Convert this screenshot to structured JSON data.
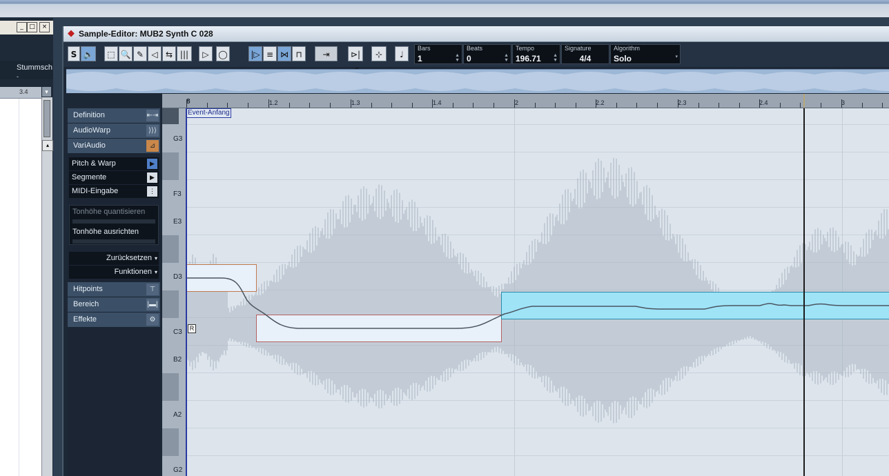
{
  "left_window": {
    "controls": [
      "_",
      "□",
      "×"
    ],
    "column_header": "Stummschalten",
    "dash": "-",
    "ruler_label": "3.4",
    "dropdown_arrow": "▾",
    "scroll_arrow": "▴"
  },
  "sample_editor": {
    "title": "Sample-Editor: MUB2 Synth C 028",
    "toolbar": {
      "buttons": [
        {
          "name": "solo-button",
          "glyph": "S"
        },
        {
          "name": "listen-button",
          "glyph": "🔈"
        },
        {
          "name": "range-select-tool",
          "glyph": "⬚"
        },
        {
          "name": "zoom-tool",
          "glyph": "🔍"
        },
        {
          "name": "draw-tool",
          "glyph": "✎"
        },
        {
          "name": "play-tool",
          "glyph": "◁"
        },
        {
          "name": "warp-tool",
          "glyph": "⇆"
        },
        {
          "name": "hitpoint-tool",
          "glyph": "|||"
        },
        {
          "name": "play-button",
          "glyph": "▷"
        },
        {
          "name": "loop-button",
          "glyph": "◯"
        },
        {
          "name": "pitch-warp-tool",
          "glyph": "|▷"
        },
        {
          "name": "segment-tool",
          "glyph": "≡"
        },
        {
          "name": "snap-tool",
          "glyph": "⋈"
        },
        {
          "name": "quantize-tool",
          "glyph": "⊓"
        },
        {
          "name": "musical-mode-button",
          "glyph": "⇥"
        },
        {
          "name": "auto-scroll-button",
          "glyph": "⊳|⊲"
        },
        {
          "name": "snap-zero-button",
          "glyph": "⊹"
        },
        {
          "name": "note-button",
          "glyph": "♩"
        }
      ],
      "fields": {
        "bars": {
          "label": "Bars",
          "value": "1"
        },
        "beats": {
          "label": "Beats",
          "value": "0"
        },
        "tempo": {
          "label": "Tempo",
          "value": "196.71"
        },
        "signature": {
          "label": "Signature",
          "value": "4/4"
        },
        "algorithm": {
          "label": "Algorithm",
          "value": "Solo"
        }
      }
    },
    "inspector": {
      "sections": [
        {
          "label": "Definition",
          "icon": "⇤⇥"
        },
        {
          "label": "AudioWarp",
          "icon": "⟩⟩⟩"
        },
        {
          "label": "VariAudio",
          "icon": "⊿"
        }
      ],
      "variaudio_modes": [
        {
          "label": "Pitch & Warp",
          "icon": "▶"
        },
        {
          "label": "Segmente",
          "icon": "▶"
        },
        {
          "label": "MIDI-Eingabe",
          "icon": "⋮"
        }
      ],
      "quantize_label": "Tonhöhe quantisieren",
      "align_label": "Tonhöhe ausrichten",
      "reset_label": "Zurücksetzen",
      "functions_label": "Funktionen",
      "lower_sections": [
        {
          "label": "Hitpoints",
          "icon": "⊤"
        },
        {
          "label": "Bereich",
          "icon": "|▬|"
        },
        {
          "label": "Effekte",
          "icon": "⚙"
        }
      ]
    },
    "ruler": {
      "labels": [
        {
          "text": "8"
        },
        {
          "text": "1.2"
        },
        {
          "text": "1.3"
        },
        {
          "text": "1.4"
        },
        {
          "text": "2"
        },
        {
          "text": "2.2"
        },
        {
          "text": "2.3"
        },
        {
          "text": "2.4"
        },
        {
          "text": "3"
        }
      ]
    },
    "pitch_labels": [
      "G3",
      "F3",
      "E3",
      "D3",
      "C3",
      "B2",
      "A2",
      "G2"
    ],
    "event_start_label": "Event-Anfang",
    "r_marker": "R",
    "colors": {
      "segment_selected_fill": "#9fe3f7",
      "segment_selected_border": "#2a8aa8",
      "segment_fill": "#e8f0fa",
      "segment_border": "#b46060",
      "waveform": "#a9b3bf",
      "pitch_curve": "#4a5560",
      "playhead": "#1a1a1a"
    }
  }
}
